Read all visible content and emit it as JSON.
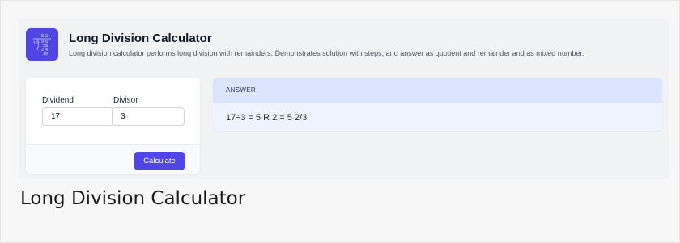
{
  "app": {
    "title": "Long Division Calculator",
    "subtitle": "Long division calculator performs long division with remainders. Demonstrates solution with steps, and answer as quotient and remainder and as mixed number.",
    "icon": "long-division-icon"
  },
  "form": {
    "dividend_label": "Dividend",
    "dividend_value": "17",
    "divisor_label": "Divisor",
    "divisor_value": "3",
    "calculate_label": "Calculate"
  },
  "answer": {
    "label": "ANSWER",
    "result": "17÷3 = 5 R 2 = 5 2/3"
  },
  "page_caption": "Long Division Calculator",
  "colors": {
    "accent": "#4f46e5",
    "answer_header": "#dbe6fe",
    "answer_body": "#eef3ff",
    "app_background": "#f1f2f4"
  }
}
